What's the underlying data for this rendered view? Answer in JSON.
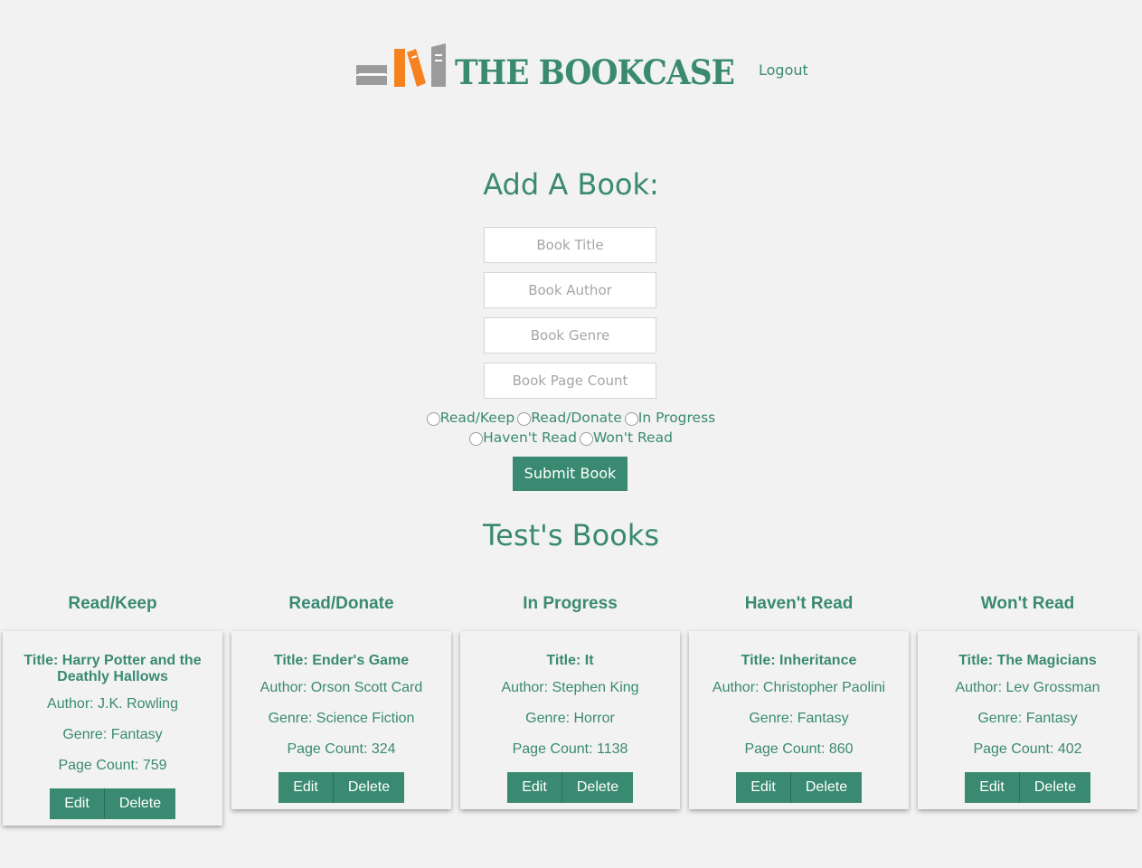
{
  "header": {
    "logo_text": "THE BOOKCASE",
    "logout_label": "Logout"
  },
  "form": {
    "title": "Add A Book:",
    "title_placeholder": "Book Title",
    "author_placeholder": "Book Author",
    "genre_placeholder": "Book Genre",
    "page_count_placeholder": "Book Page Count",
    "status_options": [
      "Read/Keep",
      "Read/Donate",
      "In Progress",
      "Haven't Read",
      "Won't Read"
    ],
    "submit_label": "Submit Book"
  },
  "books_section": {
    "title": "Test's Books"
  },
  "columns": [
    {
      "heading": "Read/Keep",
      "card": {
        "title": "Title: Harry Potter and the Deathly Hallows",
        "author": "Author: J.K. Rowling",
        "genre": "Genre: Fantasy",
        "page_count": "Page Count: 759"
      }
    },
    {
      "heading": "Read/Donate",
      "card": {
        "title": "Title: Ender's Game",
        "author": "Author: Orson Scott Card",
        "genre": "Genre: Science Fiction",
        "page_count": "Page Count: 324"
      }
    },
    {
      "heading": "In Progress",
      "card": {
        "title": "Title: It",
        "author": "Author: Stephen King",
        "genre": "Genre: Horror",
        "page_count": "Page Count: 1138"
      }
    },
    {
      "heading": "Haven't Read",
      "card": {
        "title": "Title: Inheritance",
        "author": "Author: Christopher Paolini",
        "genre": "Genre: Fantasy",
        "page_count": "Page Count: 860"
      }
    },
    {
      "heading": "Won't Read",
      "card": {
        "title": "Title: The Magicians",
        "author": "Author: Lev Grossman",
        "genre": "Genre: Fantasy",
        "page_count": "Page Count: 402"
      }
    }
  ],
  "card_buttons": {
    "edit_label": "Edit",
    "delete_label": "Delete"
  },
  "colors": {
    "accent": "#3a8a71",
    "logo_book_orange": "#f5821f",
    "logo_book_gray": "#9b9b9b",
    "background": "#f2f2f3"
  }
}
